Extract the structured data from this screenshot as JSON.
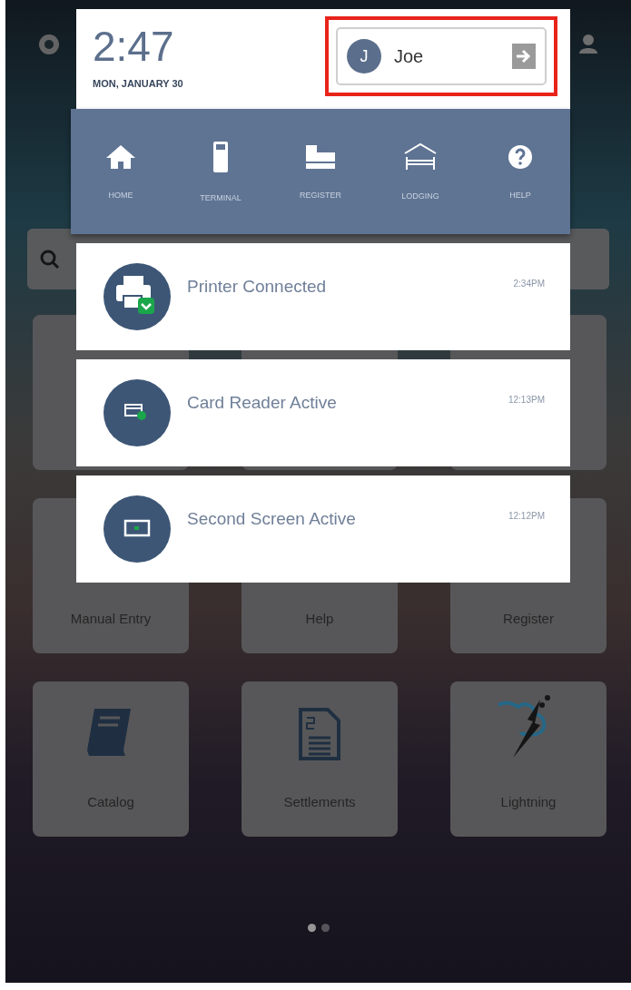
{
  "clock": {
    "time": "2:47",
    "date": "MON, JANUARY 30"
  },
  "user": {
    "initial": "J",
    "name": "Joe",
    "highlighted": true
  },
  "nav": [
    {
      "kind": "home",
      "label": "HOME"
    },
    {
      "kind": "terminal",
      "label": "TERMINAL"
    },
    {
      "kind": "register",
      "label": "REGISTER"
    },
    {
      "kind": "lodging",
      "label": "LODGING"
    },
    {
      "kind": "help",
      "label": "HELP"
    }
  ],
  "notifications": [
    {
      "kind": "printer",
      "title": "Printer Connected",
      "time": "2:34PM"
    },
    {
      "kind": "card",
      "title": "Card Reader Active",
      "time": "12:13PM"
    },
    {
      "kind": "screen",
      "title": "Second Screen Active",
      "time": "12:12PM"
    }
  ],
  "tiles": [
    {
      "kind": "blank",
      "label": "Manual Entry"
    },
    {
      "kind": "blank",
      "label": "Help"
    },
    {
      "kind": "blank",
      "label": "Register"
    },
    {
      "kind": "catalog",
      "label": "Catalog"
    },
    {
      "kind": "settlements",
      "label": "Settlements"
    },
    {
      "kind": "lightning",
      "label": "Lightning"
    }
  ],
  "page_dots": [
    {
      "selected": true
    },
    {
      "selected": false
    }
  ]
}
